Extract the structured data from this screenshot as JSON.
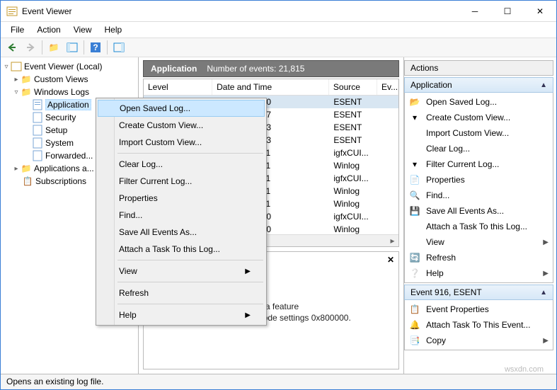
{
  "window": {
    "title": "Event Viewer"
  },
  "menubar": [
    "File",
    "Action",
    "View",
    "Help"
  ],
  "tree": {
    "root": "Event Viewer (Local)",
    "custom_views": "Custom Views",
    "windows_logs": "Windows Logs",
    "logs": [
      "Application",
      "Security",
      "Setup",
      "System",
      "Forwarded..."
    ],
    "apps": "Applications a...",
    "subs": "Subscriptions"
  },
  "center": {
    "title": "Application",
    "count_label": "Number of events: 21,815",
    "columns": {
      "level": "Level",
      "date": "Date and Time",
      "source": "Source",
      "ev": "Ev..."
    },
    "rows": [
      {
        "date": "2018 15:46:30",
        "source": "ESENT"
      },
      {
        "date": "2018 15:46:17",
        "source": "ESENT"
      },
      {
        "date": "2018 15:46:13",
        "source": "ESENT"
      },
      {
        "date": "2018 15:46:13",
        "source": "ESENT"
      },
      {
        "date": "2018 15:46:11",
        "source": "igfxCUI..."
      },
      {
        "date": "2018 15:46:11",
        "source": "Winlog"
      },
      {
        "date": "2018 15:46:11",
        "source": "igfxCUI..."
      },
      {
        "date": "2018 15:46:11",
        "source": "Winlog"
      },
      {
        "date": "2018 15:46:11",
        "source": "Winlog"
      },
      {
        "date": "2018 15:46:10",
        "source": "igfxCUI..."
      },
      {
        "date": "2018 15:46:10",
        "source": "Winlog"
      }
    ]
  },
  "detail": {
    "text": "svchost (5784,G,98) The beta feature EseDiskFlushConsist site mode settings 0x800000."
  },
  "context_menu": {
    "items": [
      "Open Saved Log...",
      "Create Custom View...",
      "Import Custom View...",
      "---",
      "Clear Log...",
      "Filter Current Log...",
      "Properties",
      "Find...",
      "Save All Events As...",
      "Attach a Task To this Log...",
      "---",
      "View",
      "---",
      "Refresh",
      "---",
      "Help"
    ],
    "submenu_markers": {
      "View": true,
      "Help": true
    },
    "hover": "Open Saved Log..."
  },
  "actions": {
    "pane_title": "Actions",
    "section1": "Application",
    "section1_items": [
      {
        "label": "Open Saved Log...",
        "icon": "folder-open-icon"
      },
      {
        "label": "Create Custom View...",
        "icon": "funnel-sparkle-icon"
      },
      {
        "label": "Import Custom View...",
        "icon": "blank-icon"
      },
      {
        "label": "Clear Log...",
        "icon": "blank-icon"
      },
      {
        "label": "Filter Current Log...",
        "icon": "funnel-icon"
      },
      {
        "label": "Properties",
        "icon": "properties-icon"
      },
      {
        "label": "Find...",
        "icon": "find-icon"
      },
      {
        "label": "Save All Events As...",
        "icon": "save-icon"
      },
      {
        "label": "Attach a Task To this Log...",
        "icon": "blank-icon"
      },
      {
        "label": "View",
        "icon": "blank-icon",
        "submenu": true
      },
      {
        "label": "Refresh",
        "icon": "refresh-icon"
      },
      {
        "label": "Help",
        "icon": "help-icon",
        "submenu": true
      }
    ],
    "section2": "Event 916, ESENT",
    "section2_items": [
      {
        "label": "Event Properties",
        "icon": "event-props-icon"
      },
      {
        "label": "Attach Task To This Event...",
        "icon": "attach-task-icon"
      },
      {
        "label": "Copy",
        "icon": "copy-icon",
        "submenu": true
      }
    ]
  },
  "statusbar": "Opens an existing log file.",
  "watermark": "wsxdn.com",
  "icons": {
    "folder-open-icon": "📂",
    "funnel-sparkle-icon": "▾",
    "funnel-icon": "▾",
    "properties-icon": "📄",
    "find-icon": "🔍",
    "save-icon": "💾",
    "refresh-icon": "🔄",
    "help-icon": "❔",
    "event-props-icon": "📋",
    "attach-task-icon": "🔔",
    "copy-icon": "📑",
    "blank-icon": " "
  }
}
